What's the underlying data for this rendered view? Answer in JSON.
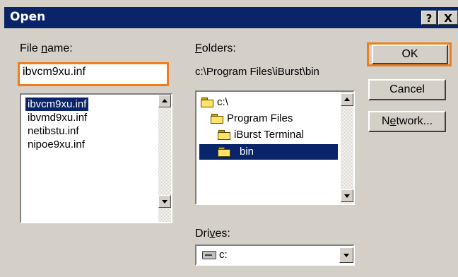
{
  "dialog": {
    "title": "Open",
    "help_button": "?",
    "close_button": "X"
  },
  "file_name": {
    "label_prefix": "File ",
    "label_underlined": "n",
    "label_suffix": "ame:",
    "value": "ibvcm9xu.inf",
    "files": [
      {
        "name": "ibvcm9xu.inf",
        "selected": true
      },
      {
        "name": "ibvmd9xu.inf",
        "selected": false
      },
      {
        "name": "netibstu.inf",
        "selected": false
      },
      {
        "name": "nipoe9xu.inf",
        "selected": false
      }
    ]
  },
  "folders": {
    "label_underlined": "F",
    "label_suffix": "olders:",
    "current_path": "c:\\Program Files\\iBurst\\bin",
    "tree": [
      {
        "name": "c:\\",
        "icon": "open-folder-icon",
        "selected": false
      },
      {
        "name": "Program Files",
        "icon": "open-folder-icon",
        "selected": false
      },
      {
        "name": "iBurst Terminal",
        "icon": "open-folder-icon",
        "selected": false
      },
      {
        "name": "bin",
        "icon": "open-folder-icon",
        "selected": true
      }
    ]
  },
  "drives": {
    "label_prefix": "Dri",
    "label_underlined": "v",
    "label_suffix": "es:",
    "selected": "c:",
    "icon": "hard-drive-icon"
  },
  "buttons": {
    "ok": "OK",
    "cancel": "Cancel",
    "network_prefix": "N",
    "network_underlined": "e",
    "network_suffix": "twork..."
  },
  "colors": {
    "titlebar": "#0a246a",
    "dialog_face": "#d4d0c8",
    "highlight_outline": "#f07d1a",
    "selection": "#0a246a"
  }
}
